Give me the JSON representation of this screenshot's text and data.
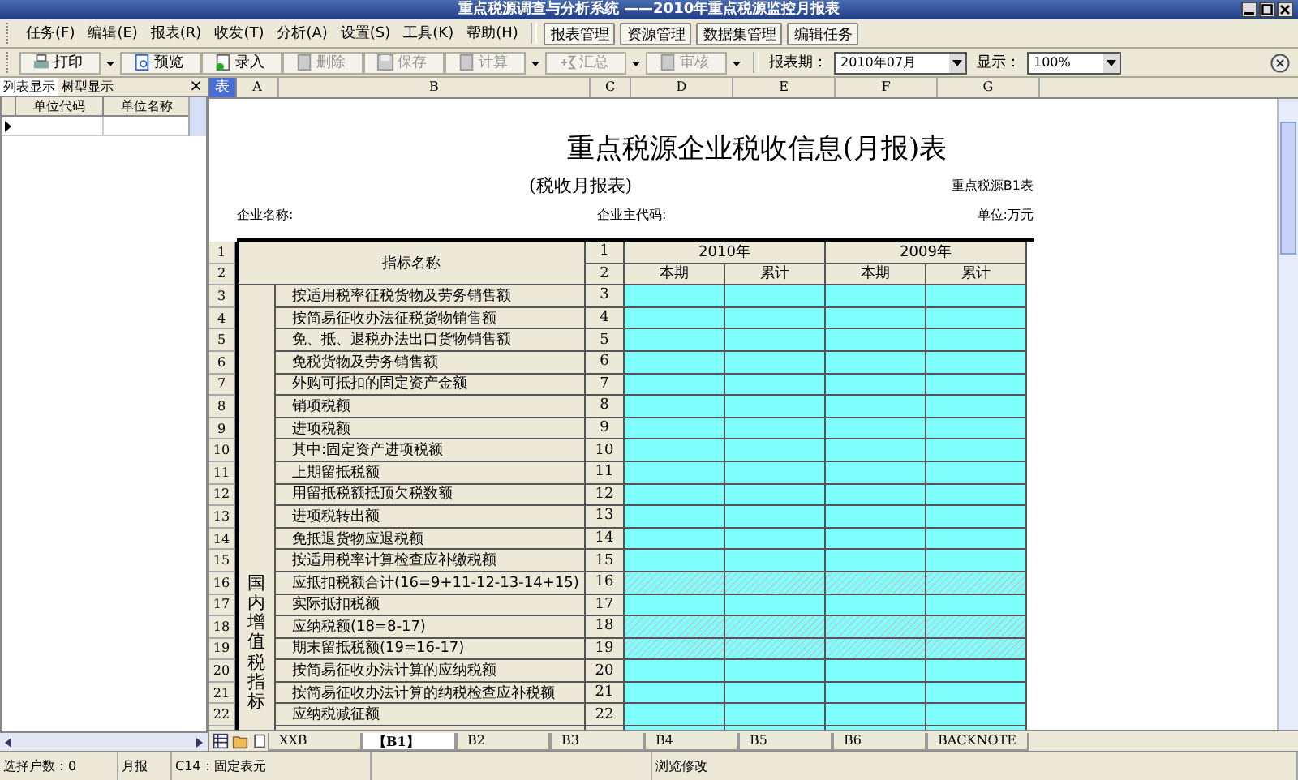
{
  "window": {
    "title": "重点税源调查与分析系统 ——2010年重点税源监控月报表"
  },
  "menu": [
    "任务(F)",
    "编辑(E)",
    "报表(R)",
    "收发(T)",
    "分析(A)",
    "设置(S)",
    "工具(K)",
    "帮助(H)"
  ],
  "menu_buttons": [
    "报表管理",
    "资源管理",
    "数据集管理",
    "编辑任务"
  ],
  "toolbar": [
    {
      "kind": "print",
      "label": "打印",
      "disabled": false,
      "dropdown": true
    },
    {
      "kind": "preview",
      "label": "预览",
      "disabled": false,
      "dropdown": false
    },
    {
      "kind": "entry",
      "label": "录入",
      "disabled": false,
      "dropdown": false
    },
    {
      "kind": "delete",
      "label": "删除",
      "disabled": true,
      "dropdown": false
    },
    {
      "kind": "save",
      "label": "保存",
      "disabled": true,
      "dropdown": false
    },
    {
      "kind": "calc",
      "label": "计算",
      "disabled": true,
      "dropdown": true
    },
    {
      "kind": "sum",
      "label": "汇总",
      "disabled": true,
      "dropdown": true
    },
    {
      "kind": "audit",
      "label": "审核",
      "disabled": true,
      "dropdown": true
    }
  ],
  "period": {
    "label": "报表期：",
    "value": "2010年07月"
  },
  "zoom": {
    "label": "显示：",
    "value": "100%"
  },
  "left_panel": {
    "tabs": [
      {
        "label": "列表显示",
        "selected": true
      },
      {
        "label": "树型显示",
        "selected": false
      }
    ],
    "close": "×",
    "columns": [
      "单位代码",
      "单位名称"
    ]
  },
  "sheet": {
    "corner": "表",
    "columns": [
      "A",
      "B",
      "C",
      "D",
      "E",
      "F",
      "G"
    ],
    "title": "重点税源企业税收信息(月报)表",
    "subtitle": "(税收月报表)",
    "form_code": "重点税源B1表",
    "company_name": "企业名称:",
    "company_code": "企业主代码:",
    "unit": "单位:万元",
    "header": {
      "row_nums": [
        "1",
        "2"
      ],
      "name": "指标名称",
      "lines": [
        "1",
        "2"
      ],
      "years": [
        "2010年",
        "2009年"
      ],
      "subcols": [
        "本期",
        "累计",
        "本期",
        "累计"
      ]
    },
    "group_label": "国内增值税指标",
    "rows": [
      {
        "num": "3",
        "label": "按适用税率征税货物及劳务销售额",
        "line": "3",
        "hatched": false
      },
      {
        "num": "4",
        "label": "按简易征收办法征税货物销售额",
        "line": "4",
        "hatched": false
      },
      {
        "num": "5",
        "label": "免、抵、退税办法出口货物销售额",
        "line": "5",
        "hatched": false
      },
      {
        "num": "6",
        "label": "免税货物及劳务销售额",
        "line": "6",
        "hatched": false
      },
      {
        "num": "7",
        "label": "外购可抵扣的固定资产金额",
        "line": "7",
        "hatched": false
      },
      {
        "num": "8",
        "label": "销项税额",
        "line": "8",
        "hatched": false
      },
      {
        "num": "9",
        "label": "进项税额",
        "line": "9",
        "hatched": false
      },
      {
        "num": "10",
        "label": "其中:固定资产进项税额",
        "line": "10",
        "hatched": false
      },
      {
        "num": "11",
        "label": "上期留抵税额",
        "line": "11",
        "hatched": false
      },
      {
        "num": "12",
        "label": "用留抵税额抵顶欠税数额",
        "line": "12",
        "hatched": false
      },
      {
        "num": "13",
        "label": "进项税转出额",
        "line": "13",
        "hatched": false
      },
      {
        "num": "14",
        "label": "免抵退货物应退税额",
        "line": "14",
        "hatched": false
      },
      {
        "num": "15",
        "label": "按适用税率计算检查应补缴税额",
        "line": "15",
        "hatched": false
      },
      {
        "num": "16",
        "label": "应抵扣税额合计(16=9+11-12-13-14+15)",
        "line": "16",
        "hatched": true
      },
      {
        "num": "17",
        "label": "实际抵扣税额",
        "line": "17",
        "hatched": false
      },
      {
        "num": "18",
        "label": "应纳税额(18=8-17)",
        "line": "18",
        "hatched": true
      },
      {
        "num": "19",
        "label": "期末留抵税额(19=16-17)",
        "line": "19",
        "hatched": true
      },
      {
        "num": "20",
        "label": "按简易征收办法计算的应纳税额",
        "line": "20",
        "hatched": false
      },
      {
        "num": "21",
        "label": "按简易征收办法计算的纳税检查应补税额",
        "line": "21",
        "hatched": false
      },
      {
        "num": "22",
        "label": "应纳税减征额",
        "line": "22",
        "hatched": false
      }
    ],
    "tabs": [
      {
        "label": "XXB",
        "selected": false
      },
      {
        "label": "【B1】",
        "selected": true
      },
      {
        "label": "B2",
        "selected": false
      },
      {
        "label": "B3",
        "selected": false
      },
      {
        "label": "B4",
        "selected": false
      },
      {
        "label": "B5",
        "selected": false
      },
      {
        "label": "B6",
        "selected": false
      },
      {
        "label": "BACKNOTE",
        "selected": false
      }
    ]
  },
  "status_bar": [
    "选择户数：0",
    "月报",
    "C14：固定表元",
    "浏览修改"
  ]
}
